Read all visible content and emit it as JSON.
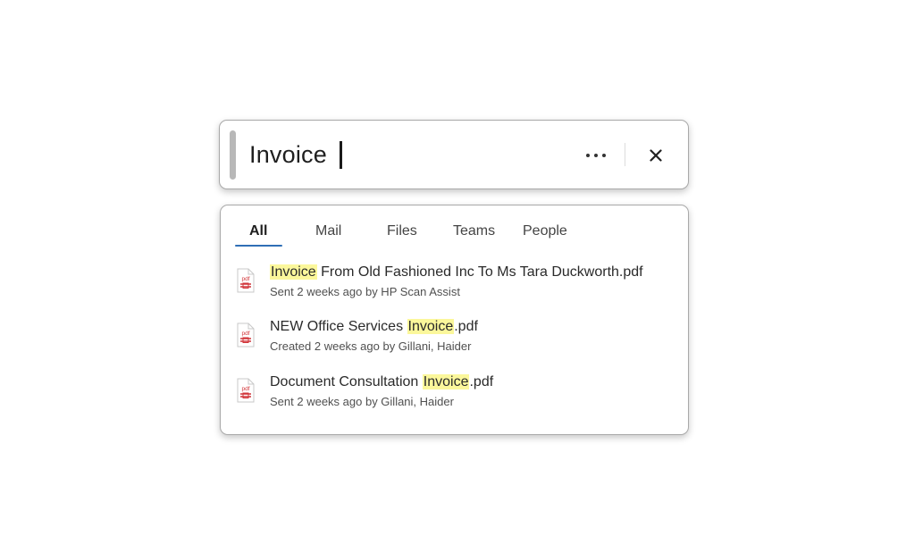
{
  "search": {
    "query": "Invoice",
    "more_icon": "more-horizontal-icon",
    "close_icon": "close-icon"
  },
  "tabs": [
    {
      "label": "All",
      "active": true
    },
    {
      "label": "Mail",
      "active": false
    },
    {
      "label": "Files",
      "active": false
    },
    {
      "label": "Teams",
      "active": false
    },
    {
      "label": "People",
      "active": false
    }
  ],
  "results": [
    {
      "icon": "pdf-file-icon",
      "title_before": "",
      "highlight": "Invoice",
      "title_after": " From Old Fashioned Inc To Ms Tara Duckworth.pdf",
      "meta": "Sent 2 weeks ago by HP Scan Assist"
    },
    {
      "icon": "pdf-file-icon",
      "title_before": "NEW Office Services ",
      "highlight": "Invoice",
      "title_after": ".pdf",
      "meta": "Created 2 weeks ago by Gillani, Haider"
    },
    {
      "icon": "pdf-file-icon",
      "title_before": "Document Consultation ",
      "highlight": "Invoice",
      "title_after": ".pdf",
      "meta": "Sent 2 weeks ago by Gillani, Haider"
    }
  ],
  "colors": {
    "highlight": "#fbf79b",
    "active_tab_underline": "#2f6fb6",
    "pdf_icon": "#d13438"
  }
}
